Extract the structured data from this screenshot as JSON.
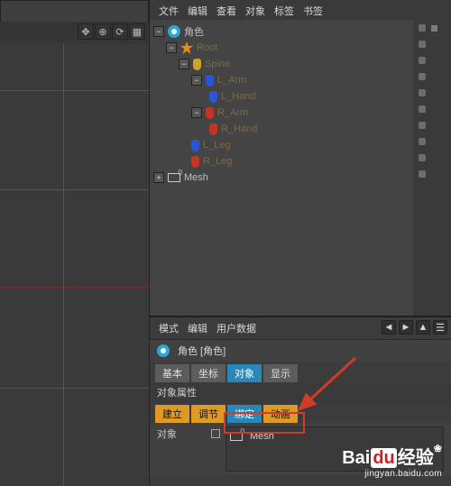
{
  "obj_menu": {
    "file": "文件",
    "edit": "编辑",
    "view": "查看",
    "object": "对象",
    "tag": "标签",
    "bookmark": "书签"
  },
  "tree": {
    "char": "角色",
    "root": "Root",
    "spine": "Spine",
    "larm": "L_Arm",
    "lhand": "L_Hand",
    "rarm": "R_Arm",
    "rhand": "R_Hand",
    "lleg": "L_Leg",
    "rleg": "R_Leg",
    "mesh": "Mesh"
  },
  "attr_menu": {
    "mode": "模式",
    "edit": "编辑",
    "userdata": "用户数据"
  },
  "attr": {
    "title": "角色 [角色]",
    "tabs": {
      "basic": "基本",
      "coord": "坐标",
      "object": "对象",
      "display": "显示",
      "build": "建立",
      "adjust": "调节",
      "bind": "绑定",
      "anim": "动画"
    },
    "section": "对象属性",
    "field_label": "对象",
    "slot_value": "Mesh"
  },
  "watermark": {
    "brand_a": "Bai",
    "brand_b": "du",
    "brand_c": "经验",
    "url": "jingyan.baidu.com"
  }
}
